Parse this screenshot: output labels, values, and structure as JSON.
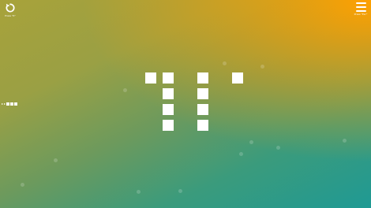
{
  "game": {
    "restart": {
      "label": "Press \"R\"",
      "icon": "restart-icon"
    },
    "menu": {
      "label": "Press \"Esc\"",
      "icon": "menu-icon"
    },
    "progress": {
      "icon": "double-chevron-icon",
      "segments_total": 3,
      "segments_filled": 3
    },
    "puzzle": {
      "cols": 6,
      "rows": 4,
      "tiles": [
        {
          "col": 0,
          "row": 0
        },
        {
          "col": 1,
          "row": 0
        },
        {
          "col": 3,
          "row": 0
        },
        {
          "col": 5,
          "row": 0
        },
        {
          "col": 1,
          "row": 1
        },
        {
          "col": 3,
          "row": 1
        },
        {
          "col": 1,
          "row": 2
        },
        {
          "col": 3,
          "row": 2
        },
        {
          "col": 1,
          "row": 3
        },
        {
          "col": 3,
          "row": 3
        }
      ]
    },
    "colors": {
      "top_right": "#ffa000",
      "bottom_left": "#1f9a94",
      "tile": "#ffffff"
    }
  }
}
